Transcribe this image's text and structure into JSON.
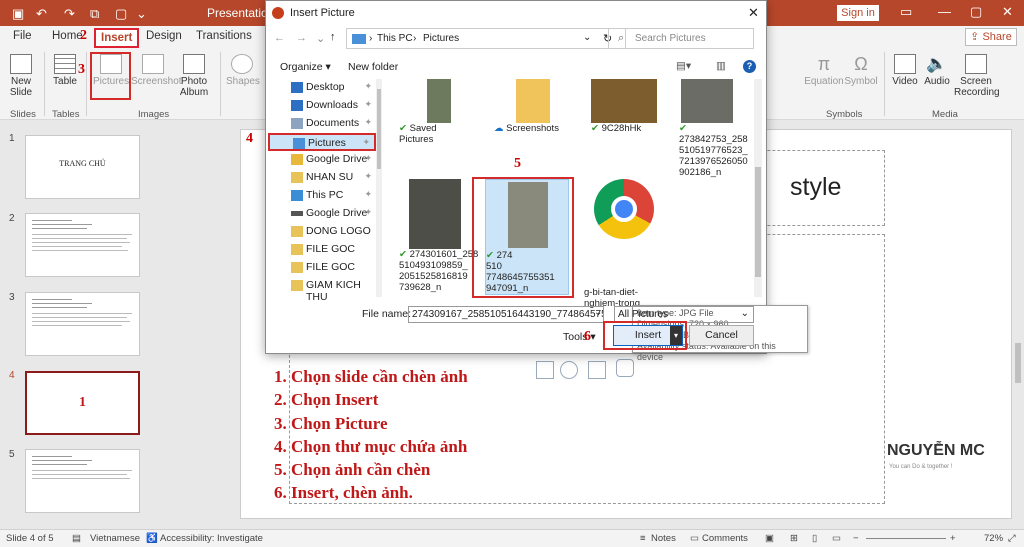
{
  "app": {
    "title": "Presentation1 - ",
    "signin": "Sign in",
    "share": "Share"
  },
  "tabs": [
    "File",
    "Home",
    "Insert",
    "Design",
    "Transitions"
  ],
  "ribbon": {
    "new_slide": "New\nSlide",
    "table": "Table",
    "pictures": "Pictures",
    "screenshot": "Screenshot",
    "photo_album": "Photo\nAlbum",
    "shapes": "Shapes",
    "equation": "Equation",
    "symbol": "Symbol",
    "video": "Video",
    "audio": "Audio",
    "screen_recording": "Screen\nRecording",
    "groups": {
      "slides": "Slides",
      "tables": "Tables",
      "images": "Images",
      "symbols": "Symbols",
      "media": "Media"
    }
  },
  "annotations": {
    "n2": "2",
    "n3": "3",
    "n4": "4",
    "n5": "5",
    "n6": "6"
  },
  "thumbnails": [
    {
      "num": "1",
      "label": "TRANG CHỦ"
    },
    {
      "num": "2",
      "label": ""
    },
    {
      "num": "3",
      "label": ""
    },
    {
      "num": "4",
      "label": "1"
    },
    {
      "num": "5",
      "label": ""
    }
  ],
  "slide": {
    "title_fragment": "style",
    "steps": [
      "1. Chọn slide cần chèn ảnh",
      "2. Chọn Insert",
      "3. Chọn Picture",
      "4. Chọn thư mục chứa ảnh",
      "5. Chọn ảnh cần chèn",
      "6. Insert, chèn ảnh."
    ],
    "logo": "NGUYỄN MC",
    "logo_sub": "You can Do & together !"
  },
  "dialog": {
    "title": "Insert Picture",
    "breadcrumb": [
      "This PC",
      "Pictures"
    ],
    "search_placeholder": "Search Pictures",
    "organize": "Organize",
    "new_folder": "New folder",
    "nav": [
      "Desktop",
      "Downloads",
      "Documents",
      "Pictures",
      "Google Drive",
      "NHAN SU",
      "This PC",
      "Google Drive",
      "DONG LOGO",
      "FILE GOC",
      "FILE GOC",
      "GIAM KICH THU"
    ],
    "files": [
      {
        "name": "Saved Pictures"
      },
      {
        "name": "Screenshots"
      },
      {
        "name": "9C28hHk"
      },
      {
        "name": "273842753_258\n510519776523_\n7213976526050\n902186_n"
      },
      {
        "name": "274301601_258\n510493109859_\n2051525816819\n739628_n"
      },
      {
        "name": "274\n510\n7748645755351\n947091_n"
      },
      {
        "name": "g-bi-tan-diet-\nnghiem-trong"
      }
    ],
    "tooltip": [
      "Item type: JPG File",
      "Dimensions: 720 x 960",
      "Size: 133 KB",
      "Availability status: Available on this device"
    ],
    "file_name_label": "File name:",
    "file_name_value": "274309167_258510516443190_77486457553519",
    "file_type": "All Pictures",
    "tools": "Tools",
    "insert": "Insert",
    "cancel": "Cancel"
  },
  "status": {
    "slide_info": "Slide 4 of 5",
    "language": "Vietnamese",
    "accessibility": "Accessibility: Investigate",
    "notes": "Notes",
    "comments": "Comments",
    "zoom": "72%"
  },
  "colors": {
    "accent": "#b7472a",
    "annotation": "#c01818"
  }
}
